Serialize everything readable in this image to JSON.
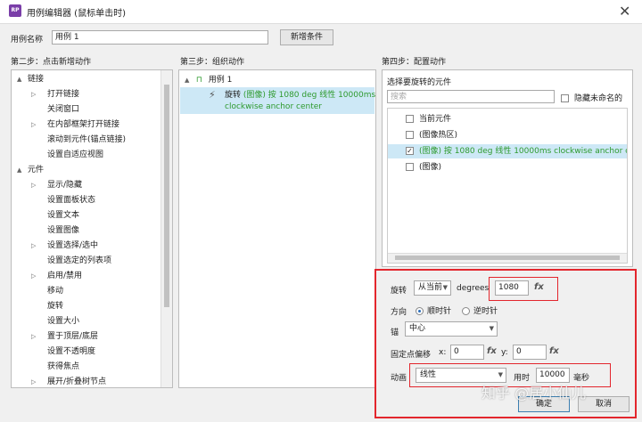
{
  "window": {
    "title": "用例编辑器 (鼠标单击时)",
    "icon_text": "RP",
    "close": "✕"
  },
  "case_name": {
    "label": "用例名称",
    "value": "用例 1",
    "add_condition": "新增条件"
  },
  "step2": {
    "heading": "第二步：点击新增动作",
    "items": [
      {
        "label": "链接",
        "level": 0,
        "expander": "▲"
      },
      {
        "label": "打开链接",
        "level": 1,
        "expander": "▷"
      },
      {
        "label": "关闭窗口",
        "level": 1,
        "expander": ""
      },
      {
        "label": "在内部框架打开链接",
        "level": 1,
        "expander": "▷"
      },
      {
        "label": "滚动到元件(锚点链接)",
        "level": 1,
        "expander": ""
      },
      {
        "label": "设置自适应视图",
        "level": 1,
        "expander": ""
      },
      {
        "label": "元件",
        "level": 0,
        "expander": "▲"
      },
      {
        "label": "显示/隐藏",
        "level": 1,
        "expander": "▷"
      },
      {
        "label": "设置面板状态",
        "level": 1,
        "expander": ""
      },
      {
        "label": "设置文本",
        "level": 1,
        "expander": ""
      },
      {
        "label": "设置图像",
        "level": 1,
        "expander": ""
      },
      {
        "label": "设置选择/选中",
        "level": 1,
        "expander": "▷"
      },
      {
        "label": "设置选定的列表项",
        "level": 1,
        "expander": ""
      },
      {
        "label": "启用/禁用",
        "level": 1,
        "expander": "▷"
      },
      {
        "label": "移动",
        "level": 1,
        "expander": ""
      },
      {
        "label": "旋转",
        "level": 1,
        "expander": ""
      },
      {
        "label": "设置大小",
        "level": 1,
        "expander": ""
      },
      {
        "label": "置于顶层/底层",
        "level": 1,
        "expander": "▷"
      },
      {
        "label": "设置不透明度",
        "level": 1,
        "expander": ""
      },
      {
        "label": "获得焦点",
        "level": 1,
        "expander": ""
      },
      {
        "label": "展开/折叠树节点",
        "level": 1,
        "expander": "▷"
      }
    ]
  },
  "step3": {
    "heading": "第三步：组织动作",
    "case_label": "用例 1",
    "action_prefix": "旋转 ",
    "action_green": "(图像) 按 1080 deg 线性 10000ms",
    "action_green2": "clockwise anchor center"
  },
  "step4": {
    "heading": "第四步：配置动作",
    "select_label": "选择要旋转的元件",
    "search_placeholder": "搜索",
    "hide_unnamed": "隐藏未命名的",
    "widgets": [
      {
        "label": "当前元件",
        "checked": false
      },
      {
        "label": "(图像热区)",
        "checked": false
      },
      {
        "label": "(图像) 按 1080 deg 线性 10000ms clockwise anchor center",
        "checked": true
      },
      {
        "label": "(图像)",
        "checked": false
      }
    ],
    "config": {
      "rotate_label": "旋转",
      "rotate_mode": "从当前",
      "degrees_label": "degrees",
      "degrees_value": "1080",
      "fx": "fx",
      "direction_label": "方向",
      "clockwise": "顺时针",
      "counterclockwise": "逆时针",
      "anchor_label": "锚",
      "anchor_value": "中心",
      "offset_label": "固定点偏移",
      "x_label": "x:",
      "x_value": "0",
      "y_label": "y:",
      "y_value": "0",
      "anim_label": "动画",
      "anim_value": "线性",
      "duration_label": "用时",
      "duration_value": "10000",
      "ms_label": "毫秒"
    }
  },
  "footer": {
    "ok": "确定",
    "cancel": "取消"
  },
  "watermark": "知乎 @居小仙儿"
}
